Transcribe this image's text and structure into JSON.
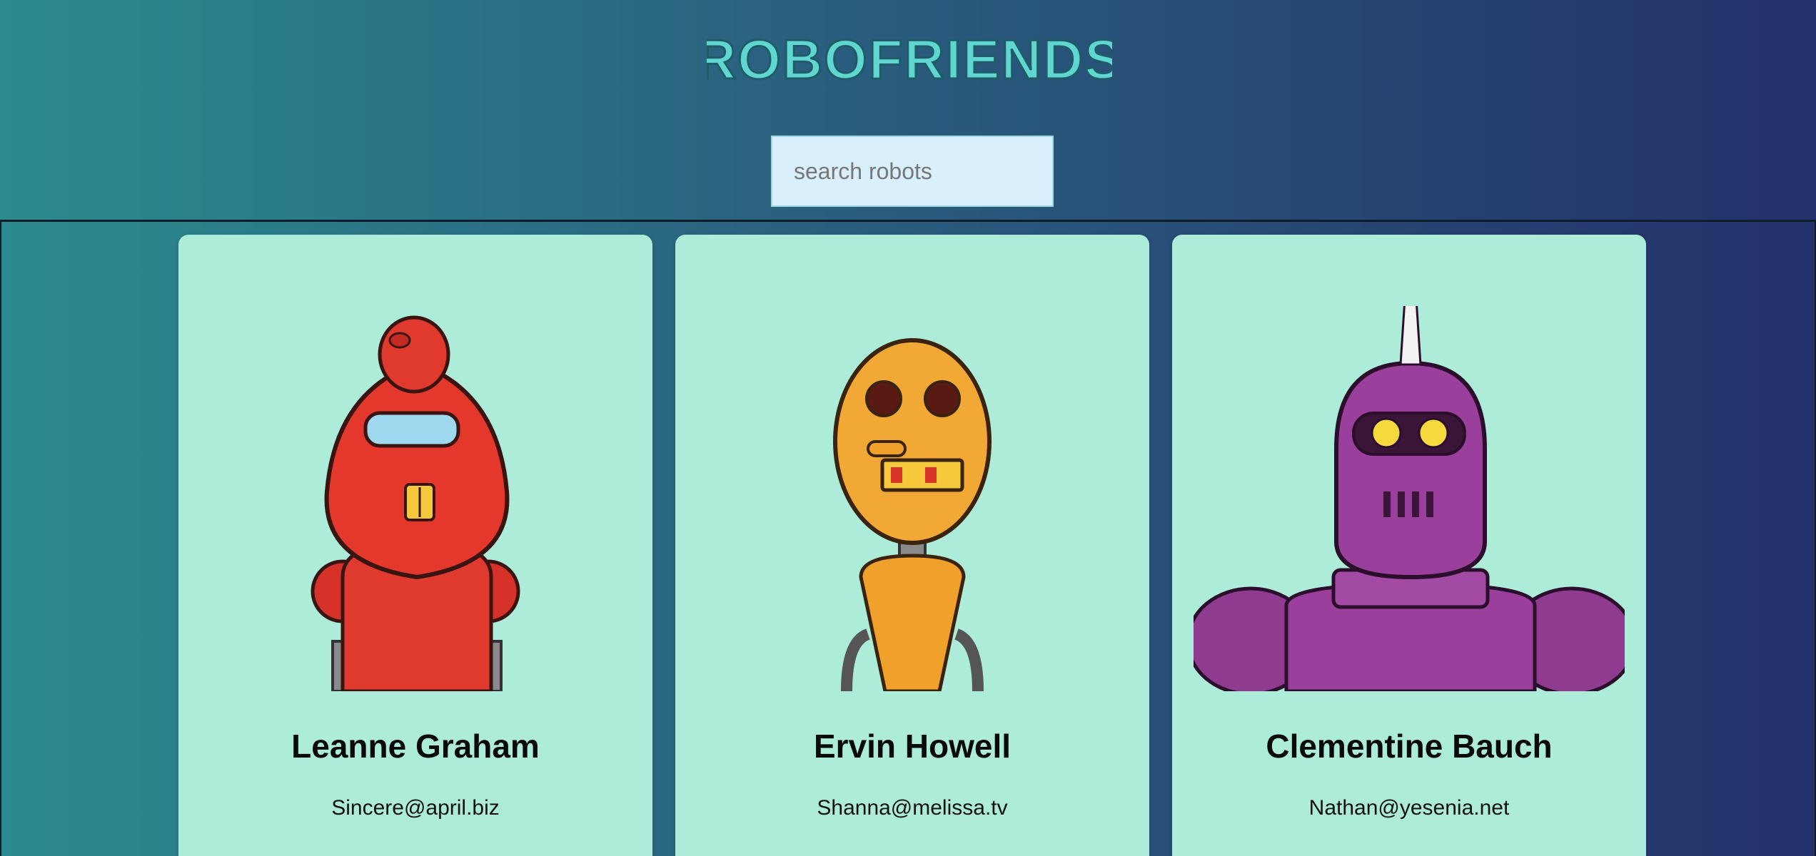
{
  "app": {
    "title": "ROBOFRIENDS"
  },
  "search": {
    "placeholder": "search robots",
    "value": ""
  },
  "robots": [
    {
      "name": "Leanne Graham",
      "email": "Sincere@april.biz",
      "avatar": "red-robot-icon",
      "color": "#e03a2e"
    },
    {
      "name": "Ervin Howell",
      "email": "Shanna@melissa.tv",
      "avatar": "orange-robot-icon",
      "color": "#f0a12c"
    },
    {
      "name": "Clementine Bauch",
      "email": "Nathan@yesenia.net",
      "avatar": "purple-robot-icon",
      "color": "#9b3f9d"
    }
  ],
  "theme": {
    "background_start": "#2b8a8e",
    "background_end": "#23306a",
    "card": "#aeecda",
    "logo": "#5fd6d0"
  }
}
